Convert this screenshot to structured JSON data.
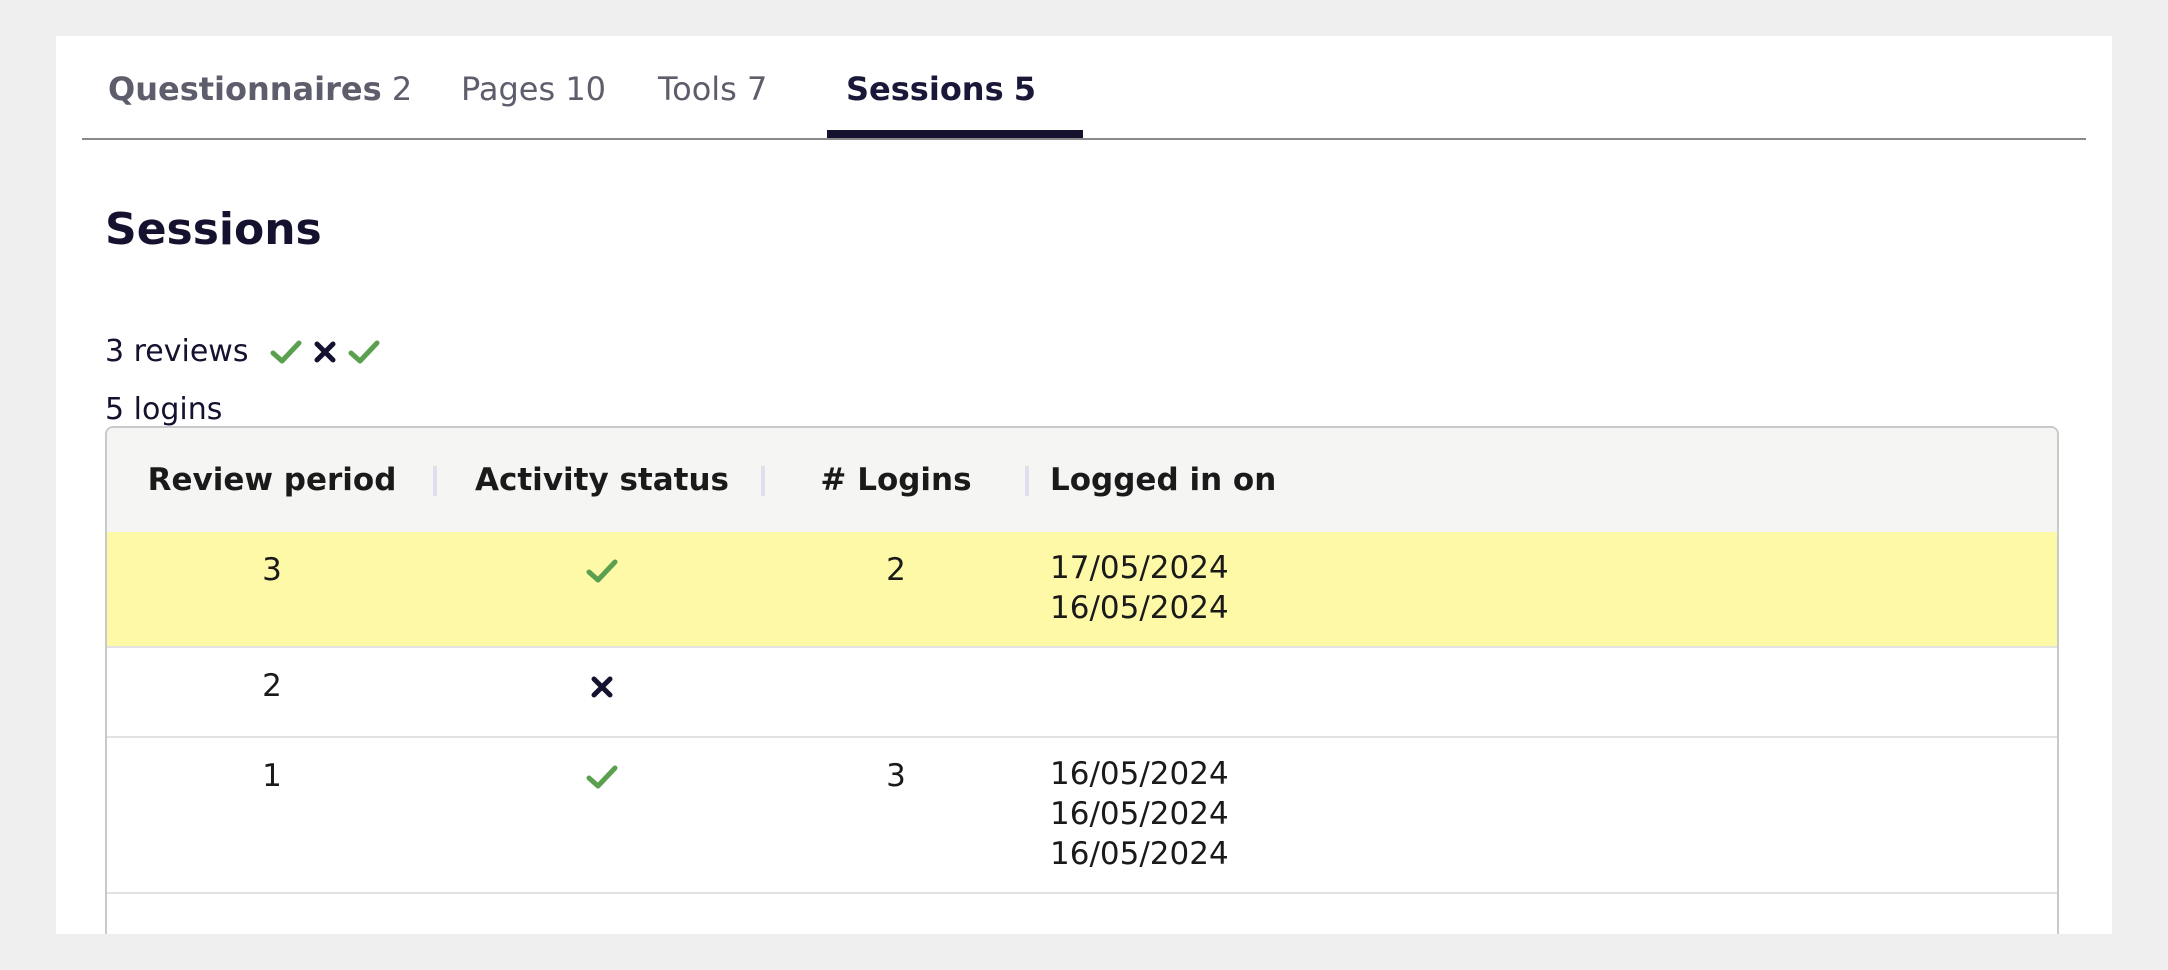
{
  "tabs": [
    {
      "name": "Questionnaires",
      "count": "2"
    },
    {
      "name": "Pages",
      "count": "10"
    },
    {
      "name": "Tools",
      "count": "7"
    },
    {
      "name": "Sessions",
      "count": "5"
    }
  ],
  "active_tab": "Sessions",
  "section_title": "Sessions",
  "summary": {
    "reviews_text": "3 reviews",
    "review_icons": [
      "check-icon",
      "cross-icon",
      "check-icon"
    ],
    "logins_text": "5 logins"
  },
  "table": {
    "headers": [
      "Review period",
      "Activity status",
      "# Logins",
      "Logged in on"
    ],
    "rows": [
      {
        "period": "3",
        "status": "check-icon",
        "logins": "2",
        "dates": [
          "17/05/2024",
          "16/05/2024"
        ],
        "highlighted": true
      },
      {
        "period": "2",
        "status": "cross-icon",
        "logins": "",
        "dates": [],
        "highlighted": false
      },
      {
        "period": "1",
        "status": "check-icon",
        "logins": "3",
        "dates": [
          "16/05/2024",
          "16/05/2024",
          "16/05/2024"
        ],
        "highlighted": false
      }
    ]
  },
  "colors": {
    "check": "#5aa04e",
    "cross": "#14122e",
    "highlight": "#fdf9a6",
    "active_tab": "#14122e"
  }
}
